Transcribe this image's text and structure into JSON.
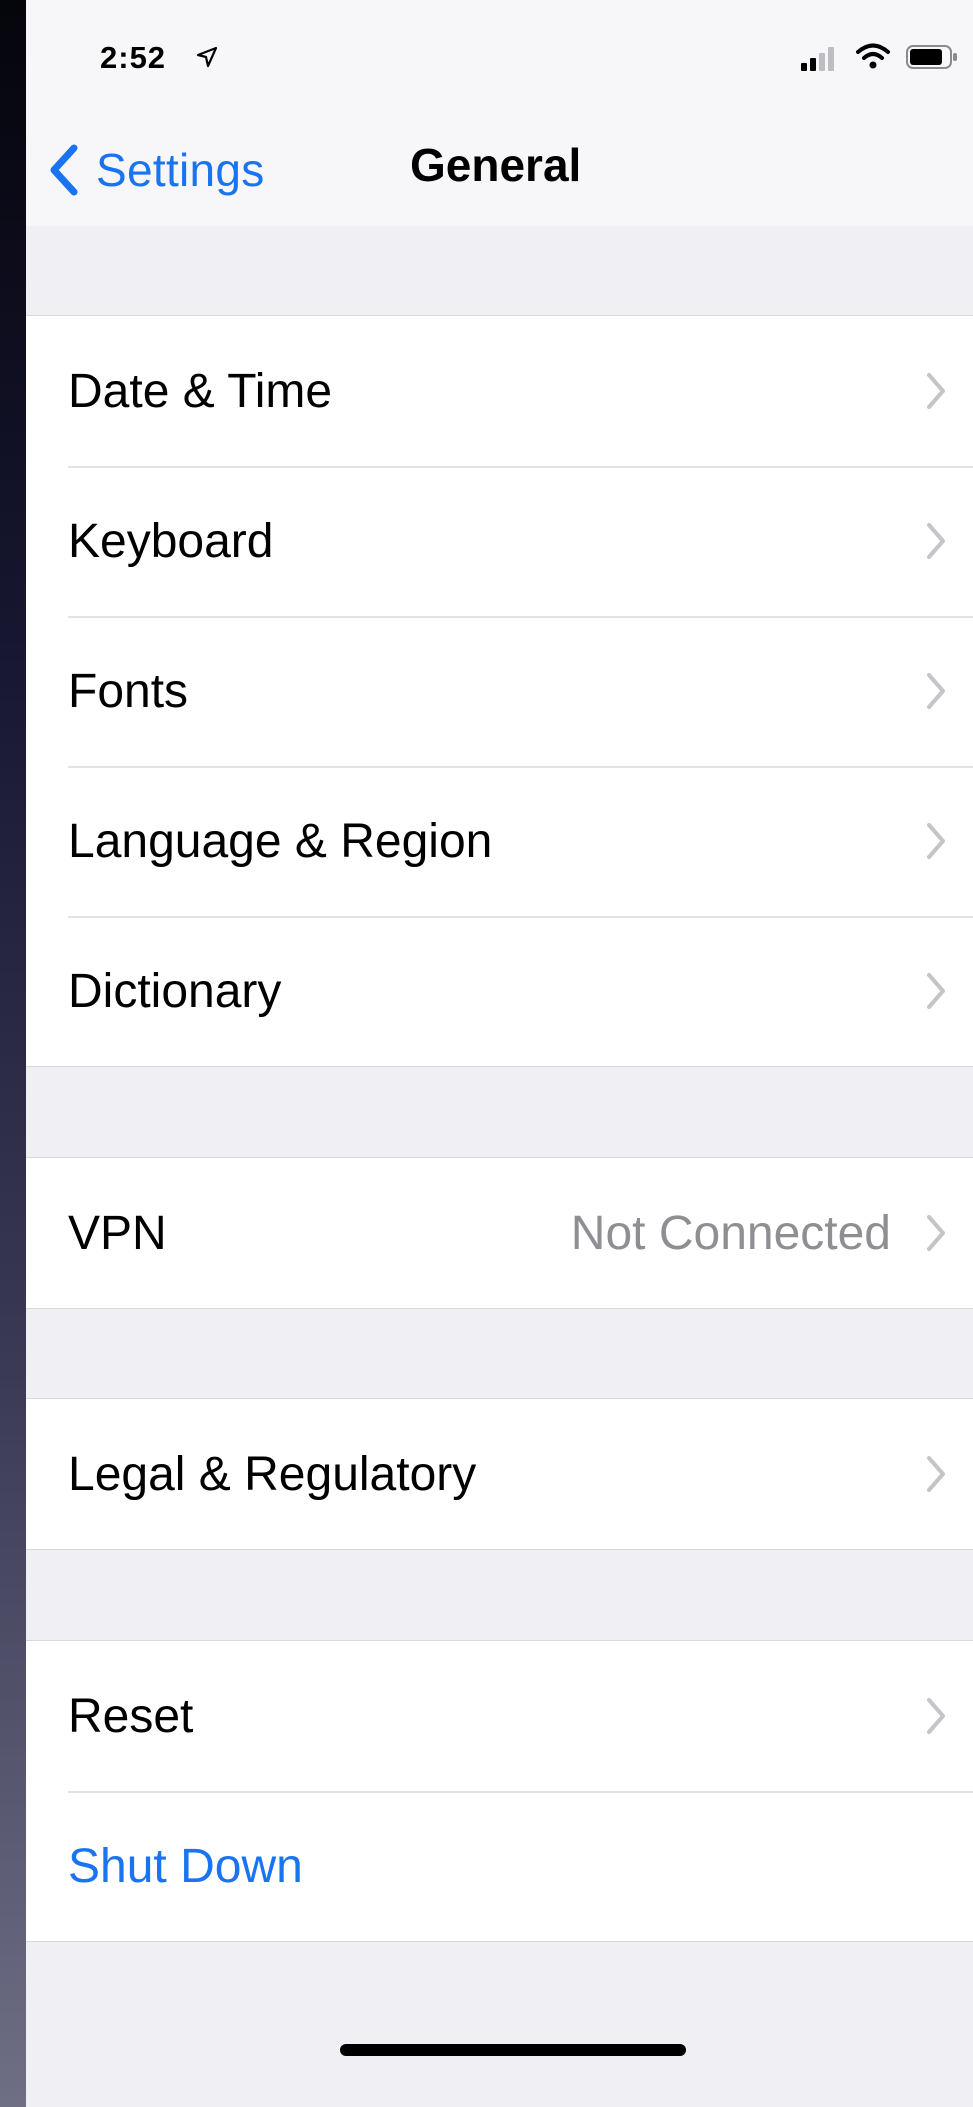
{
  "status_bar": {
    "time": "2:52",
    "location_icon": "location-arrow-icon",
    "signal_icon": "cellular-signal-icon",
    "wifi_icon": "wifi-icon",
    "battery_icon": "battery-icon"
  },
  "nav": {
    "back_label": "Settings",
    "title": "General"
  },
  "groups": [
    {
      "rows": [
        {
          "label": "Date & Time"
        },
        {
          "label": "Keyboard"
        },
        {
          "label": "Fonts"
        },
        {
          "label": "Language & Region"
        },
        {
          "label": "Dictionary"
        }
      ]
    },
    {
      "rows": [
        {
          "label": "VPN",
          "value": "Not Connected"
        }
      ]
    },
    {
      "rows": [
        {
          "label": "Legal & Regulatory"
        }
      ]
    },
    {
      "rows": [
        {
          "label": "Reset"
        },
        {
          "label": "Shut Down"
        }
      ]
    }
  ],
  "colors": {
    "accent": "#1a73f0",
    "background": "#efeff4",
    "secondary_text": "#8e8e93"
  }
}
